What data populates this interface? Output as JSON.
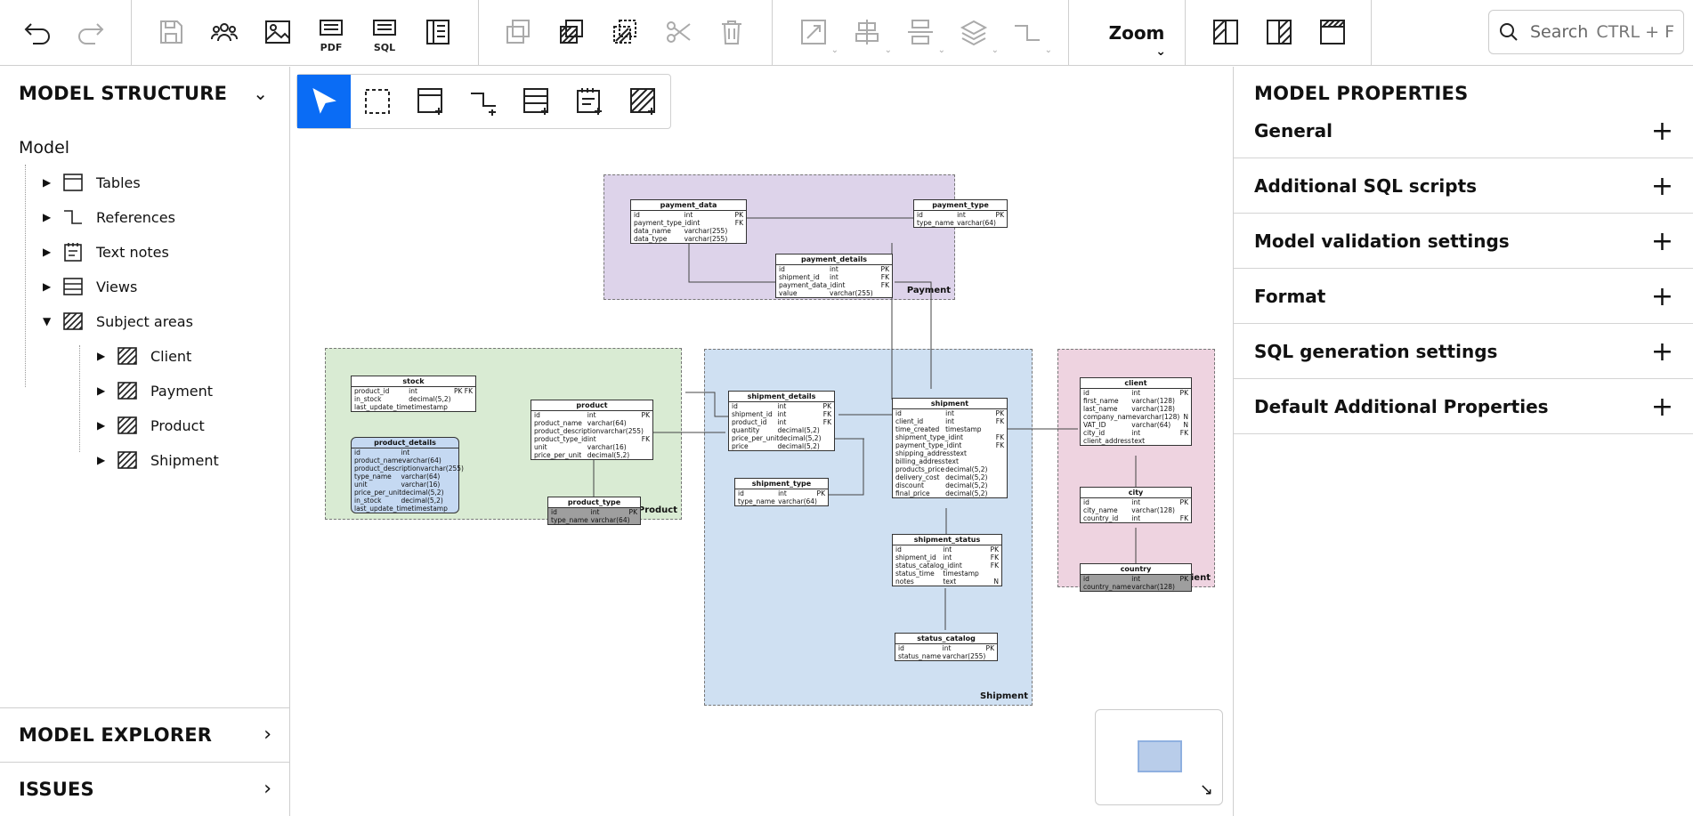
{
  "toolbar": {
    "pdf_label": "PDF",
    "sql_label": "SQL",
    "zoom_label": "Zoom",
    "search_placeholder": "Search",
    "search_shortcut": "CTRL + F"
  },
  "left_panel": {
    "title": "MODEL STRUCTURE",
    "root": "Model",
    "items": [
      {
        "label": "Tables",
        "icon": "table-icon"
      },
      {
        "label": "References",
        "icon": "reference-icon"
      },
      {
        "label": "Text notes",
        "icon": "note-icon"
      },
      {
        "label": "Views",
        "icon": "view-icon"
      },
      {
        "label": "Subject areas",
        "icon": "subject-area-icon"
      }
    ],
    "subject_areas": [
      "Client",
      "Payment",
      "Product",
      "Shipment"
    ],
    "explorer": "MODEL EXPLORER",
    "issues": "ISSUES"
  },
  "right_panel": {
    "title": "MODEL PROPERTIES",
    "sections": [
      "General",
      "Additional SQL scripts",
      "Model validation settings",
      "Format",
      "SQL generation settings",
      "Default Additional Properties"
    ]
  },
  "diagram": {
    "areas": {
      "payment": "Payment",
      "product": "Product",
      "shipment": "Shipment",
      "client": "Client"
    },
    "colors": {
      "payment": "#ddd3ea",
      "product": "#d9ebd3",
      "shipment": "#cfe0f2",
      "client": "#eed3e0",
      "accent": "#0a6cf5"
    },
    "tables": {
      "payment_data": {
        "name": "payment_data",
        "rows": [
          [
            "id",
            "int",
            "PK"
          ],
          [
            "payment_type_id",
            "int",
            "FK"
          ],
          [
            "data_name",
            "varchar(255)",
            ""
          ],
          [
            "data_type",
            "varchar(255)",
            ""
          ]
        ]
      },
      "payment_type": {
        "name": "payment_type",
        "rows": [
          [
            "id",
            "int",
            "PK"
          ],
          [
            "type_name",
            "varchar(64)",
            ""
          ]
        ]
      },
      "payment_details": {
        "name": "payment_details",
        "rows": [
          [
            "id",
            "int",
            "PK"
          ],
          [
            "shipment_id",
            "int",
            "FK"
          ],
          [
            "payment_data_id",
            "int",
            "FK"
          ],
          [
            "value",
            "varchar(255)",
            ""
          ]
        ]
      },
      "stock": {
        "name": "stock",
        "rows": [
          [
            "product_id",
            "int",
            "PK FK"
          ],
          [
            "in_stock",
            "decimal(5,2)",
            ""
          ],
          [
            "last_update_time",
            "timestamp",
            ""
          ]
        ]
      },
      "product_details": {
        "name": "product_details",
        "rows": [
          [
            "id",
            "int",
            ""
          ],
          [
            "product_name",
            "varchar(64)",
            ""
          ],
          [
            "product_description",
            "varchar(255)",
            ""
          ],
          [
            "type_name",
            "varchar(64)",
            ""
          ],
          [
            "unit",
            "varchar(16)",
            ""
          ],
          [
            "price_per_unit",
            "decimal(5,2)",
            ""
          ],
          [
            "in_stock",
            "decimal(5,2)",
            ""
          ],
          [
            "last_update_time",
            "timestamp",
            ""
          ]
        ]
      },
      "product": {
        "name": "product",
        "rows": [
          [
            "id",
            "int",
            "PK"
          ],
          [
            "product_name",
            "varchar(64)",
            ""
          ],
          [
            "product_description",
            "varchar(255)",
            ""
          ],
          [
            "product_type_id",
            "int",
            "FK"
          ],
          [
            "unit",
            "varchar(16)",
            ""
          ],
          [
            "price_per_unit",
            "decimal(5,2)",
            ""
          ]
        ]
      },
      "product_type": {
        "name": "product_type",
        "rows": [
          [
            "id",
            "int",
            "PK"
          ],
          [
            "type_name",
            "varchar(64)",
            ""
          ]
        ]
      },
      "shipment_details": {
        "name": "shipment_details",
        "rows": [
          [
            "id",
            "int",
            "PK"
          ],
          [
            "shipment_id",
            "int",
            "FK"
          ],
          [
            "product_id",
            "int",
            "FK"
          ],
          [
            "quantity",
            "decimal(5,2)",
            ""
          ],
          [
            "price_per_unit",
            "decimal(5,2)",
            ""
          ],
          [
            "price",
            "decimal(5,2)",
            ""
          ]
        ]
      },
      "shipment_type": {
        "name": "shipment_type",
        "rows": [
          [
            "id",
            "int",
            "PK"
          ],
          [
            "type_name",
            "varchar(64)",
            ""
          ]
        ]
      },
      "shipment": {
        "name": "shipment",
        "rows": [
          [
            "id",
            "int",
            "PK"
          ],
          [
            "client_id",
            "int",
            "FK"
          ],
          [
            "time_created",
            "timestamp",
            ""
          ],
          [
            "shipment_type_id",
            "int",
            "FK"
          ],
          [
            "payment_type_id",
            "int",
            "FK"
          ],
          [
            "shipping_address",
            "text",
            ""
          ],
          [
            "billing_address",
            "text",
            ""
          ],
          [
            "products_price",
            "decimal(5,2)",
            ""
          ],
          [
            "delivery_cost",
            "decimal(5,2)",
            ""
          ],
          [
            "discount",
            "decimal(5,2)",
            ""
          ],
          [
            "final_price",
            "decimal(5,2)",
            ""
          ]
        ]
      },
      "shipment_status": {
        "name": "shipment_status",
        "rows": [
          [
            "id",
            "int",
            "PK"
          ],
          [
            "shipment_id",
            "int",
            "FK"
          ],
          [
            "status_catalog_id",
            "int",
            "FK"
          ],
          [
            "status_time",
            "timestamp",
            ""
          ],
          [
            "notes",
            "text",
            "N"
          ]
        ]
      },
      "status_catalog": {
        "name": "status_catalog",
        "rows": [
          [
            "id",
            "int",
            "PK"
          ],
          [
            "status_name",
            "varchar(255)",
            ""
          ]
        ]
      },
      "client": {
        "name": "client",
        "rows": [
          [
            "id",
            "int",
            "PK"
          ],
          [
            "first_name",
            "varchar(128)",
            ""
          ],
          [
            "last_name",
            "varchar(128)",
            ""
          ],
          [
            "company_name",
            "varchar(128)",
            "N"
          ],
          [
            "VAT_ID",
            "varchar(64)",
            "N"
          ],
          [
            "city_id",
            "int",
            "FK"
          ],
          [
            "client_address",
            "text",
            ""
          ]
        ]
      },
      "city": {
        "name": "city",
        "rows": [
          [
            "id",
            "int",
            "PK"
          ],
          [
            "city_name",
            "varchar(128)",
            ""
          ],
          [
            "country_id",
            "int",
            "FK"
          ]
        ]
      },
      "country": {
        "name": "country",
        "rows": [
          [
            "id",
            "int",
            "PK"
          ],
          [
            "country_name",
            "varchar(128)",
            ""
          ]
        ]
      }
    }
  }
}
